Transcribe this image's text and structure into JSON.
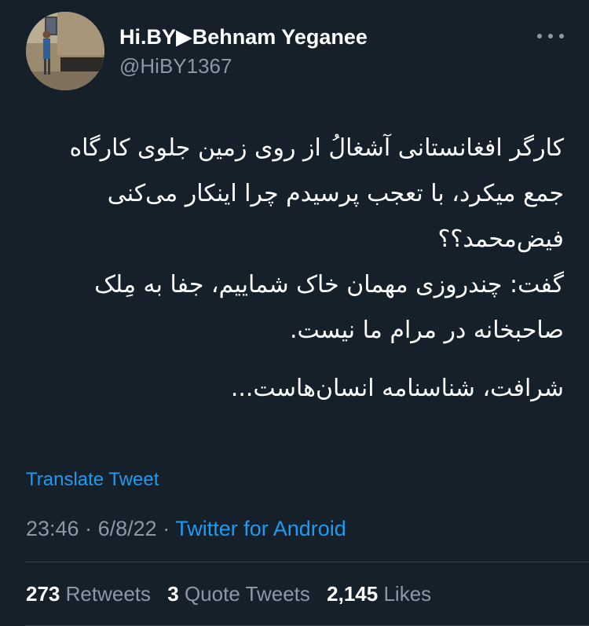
{
  "user": {
    "display_name": "Hi.BY▶Behnam Yeganee",
    "handle": "@HiBY1367"
  },
  "tweet": {
    "paragraphs": [
      "کارگر افغانستانی آشغالُ از روی زمین جلوی کارگاه جمع میکرد، با تعجب پرسیدم چرا اینکار می‌کنی فیض‌محمد؟؟",
      "گفت: چندروزی مهمان خاک شماییم، جفا به مِلک صاحبخانه در مرام ما نیست.",
      "شرافت، شناسنامه انسان‌هاست..."
    ],
    "translate_label": "Translate Tweet",
    "time": "23:46",
    "separator": "·",
    "date": "6/8/22",
    "source": "Twitter for Android"
  },
  "stats": {
    "retweets_count": "273",
    "retweets_label": "Retweets",
    "quotes_count": "3",
    "quotes_label": "Quote Tweets",
    "likes_count": "2,145",
    "likes_label": "Likes"
  },
  "icons": {
    "more": "more-horizontal-icon"
  },
  "colors": {
    "background": "#15202b",
    "accent": "#1d9bf0",
    "secondary_text": "#8b98a5",
    "divider": "#38444d"
  }
}
